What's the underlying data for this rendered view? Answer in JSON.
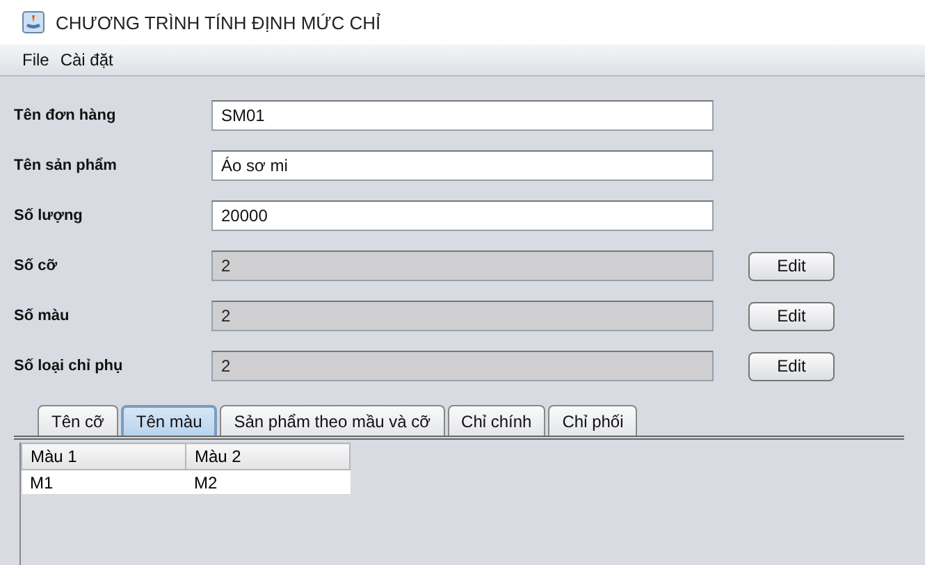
{
  "window": {
    "title": "CHƯƠNG TRÌNH TÍNH ĐỊNH MỨC CHỈ"
  },
  "menu": [
    "File",
    "Cài đặt"
  ],
  "fields": [
    {
      "label": "Tên đơn hàng",
      "value": "SM01",
      "disabled": false
    },
    {
      "label": "Tên sản phẩm",
      "value": "Áo sơ mi",
      "disabled": false
    },
    {
      "label": "Số lượng",
      "value": "20000",
      "disabled": false
    },
    {
      "label": "Số cỡ",
      "value": "2",
      "disabled": true,
      "button": "Edit"
    },
    {
      "label": "Số màu",
      "value": "2",
      "disabled": true,
      "button": "Edit"
    },
    {
      "label": "Số loại chỉ phụ",
      "value": "2",
      "disabled": true,
      "button": "Edit"
    }
  ],
  "tabs": [
    {
      "label": "Tên cỡ",
      "selected": false
    },
    {
      "label": "Tên màu",
      "selected": true
    },
    {
      "label": "Sản phẩm theo mầu và cỡ",
      "selected": false
    },
    {
      "label": "Chỉ chính",
      "selected": false
    },
    {
      "label": "Chỉ phối",
      "selected": false
    }
  ],
  "table": {
    "columns": [
      "Màu 1",
      "Màu 2"
    ],
    "rows": [
      [
        "M1",
        "M2"
      ]
    ]
  }
}
